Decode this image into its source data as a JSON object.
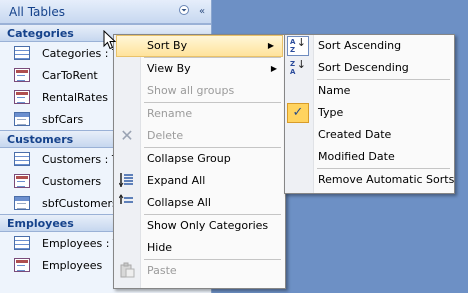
{
  "nav": {
    "title": "All Tables",
    "groups": [
      {
        "name": "Categories",
        "items": [
          {
            "label": "Categories : Ta",
            "icon": "table-icon"
          },
          {
            "label": "CarToRent",
            "icon": "form-icon"
          },
          {
            "label": "RentalRates",
            "icon": "form-icon"
          },
          {
            "label": "sbfCars",
            "icon": "report-icon"
          }
        ]
      },
      {
        "name": "Customers",
        "items": [
          {
            "label": "Customers : Ta",
            "icon": "table-icon"
          },
          {
            "label": "Customers",
            "icon": "form-icon"
          },
          {
            "label": "sbfCustomers",
            "icon": "report-icon"
          }
        ]
      },
      {
        "name": "Employees",
        "items": [
          {
            "label": "Employees : Ta",
            "icon": "table-icon"
          },
          {
            "label": "Employees",
            "icon": "form-icon"
          }
        ]
      }
    ]
  },
  "context_menu": {
    "sort_by": "Sort By",
    "view_by": "View By",
    "show_all_groups": "Show all groups",
    "rename": "Rename",
    "delete": "Delete",
    "collapse_group": "Collapse Group",
    "expand_all": "Expand All",
    "collapse_all": "Collapse All",
    "show_only_categories": "Show Only Categories",
    "hide": "Hide",
    "paste": "Paste"
  },
  "sort_submenu": {
    "sort_ascending": "Sort Ascending",
    "sort_descending": "Sort Descending",
    "name": "Name",
    "type": "Type",
    "created_date": "Created Date",
    "modified_date": "Modified Date",
    "remove_automatic_sorts": "Remove Automatic Sorts",
    "checked_item": "Type"
  },
  "colors": {
    "highlight": "#ffe39b",
    "nav_group_text": "#15428b",
    "background": "#6d90c5"
  }
}
